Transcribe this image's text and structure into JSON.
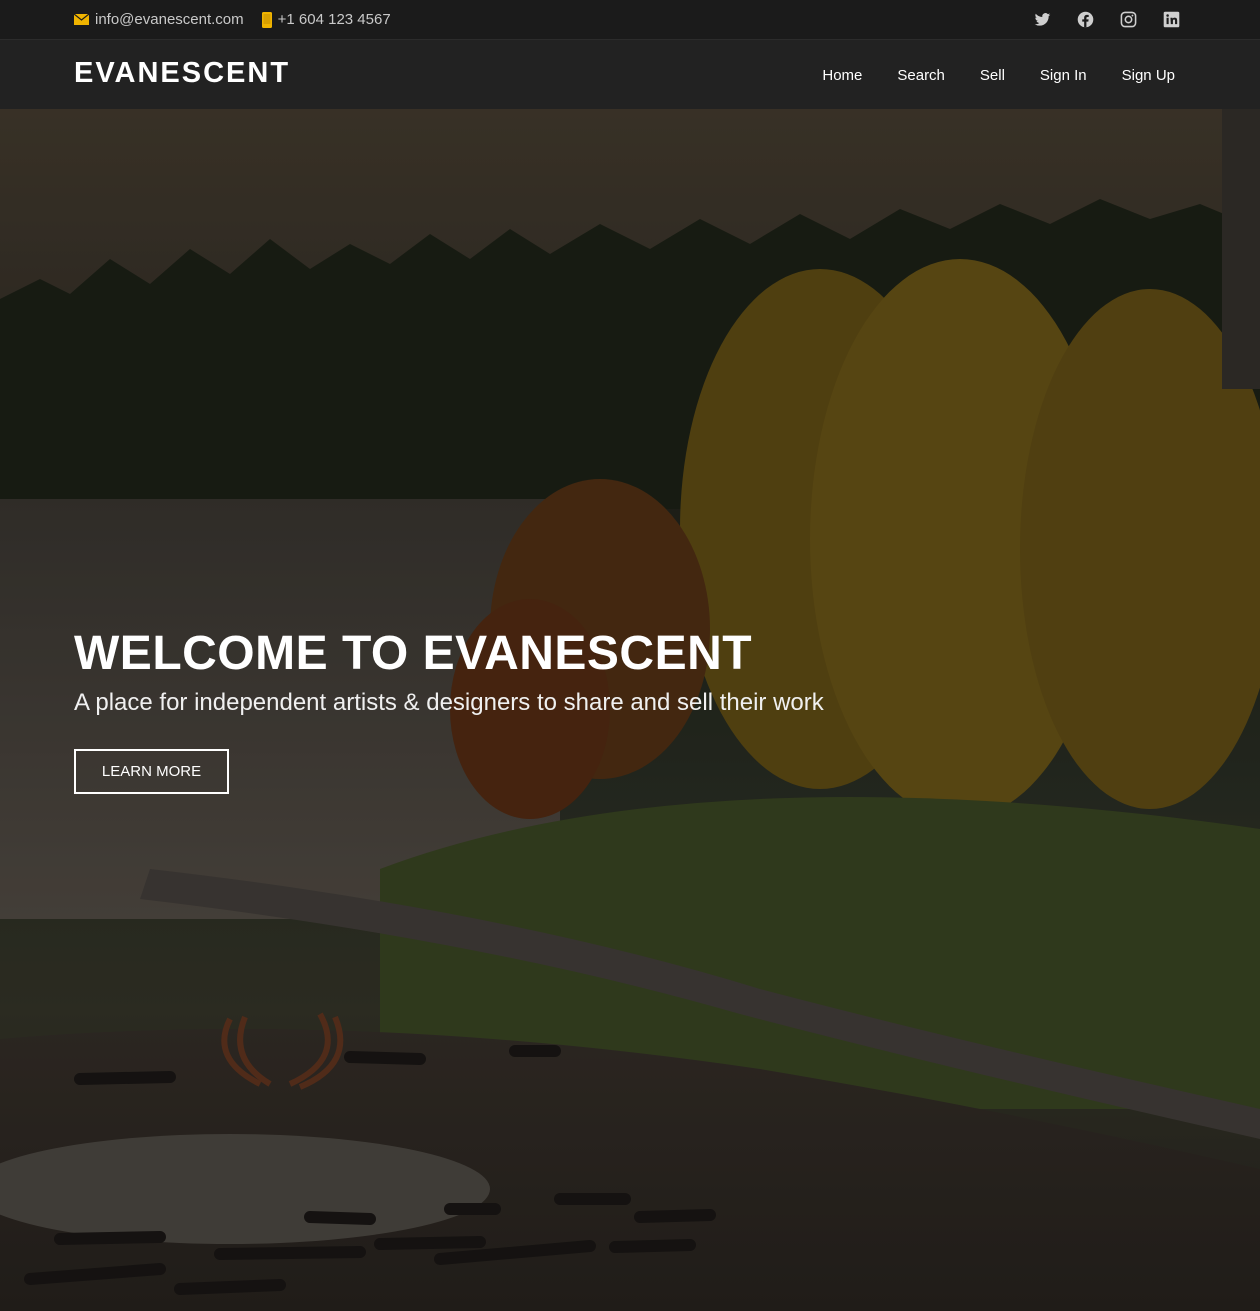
{
  "topbar": {
    "email": "info@evanescent.com",
    "phone": "+1 604 123 4567",
    "social": [
      {
        "icon": "twitter-icon"
      },
      {
        "icon": "facebook-icon"
      },
      {
        "icon": "instagram-icon"
      },
      {
        "icon": "linkedin-icon"
      }
    ],
    "accent_color": "#f0b400"
  },
  "navbar": {
    "brand": "EVANESCENT",
    "menu": [
      "Home",
      "Search",
      "Sell",
      "Sign In",
      "Sign Up"
    ]
  },
  "hero": {
    "title": "WELCOME TO EVANESCENT",
    "subtitle": "A place for independent artists & designers to share and sell their work",
    "button": "LEARN MORE"
  }
}
